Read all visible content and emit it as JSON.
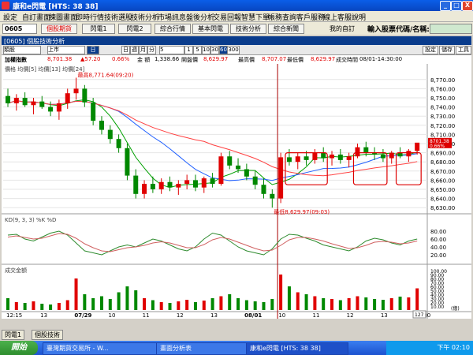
{
  "window": {
    "title": "康和e閃電 [HTS: 38 38]",
    "min": "_",
    "max": "□",
    "close": "X"
  },
  "menu": [
    "設定",
    "自訂畫面",
    "揀圖畫面",
    "即時行情",
    "技術選股",
    "技術分析",
    "市場訊息",
    "盤後分析",
    "交易回報",
    "智慧下單",
    "帳務查詢",
    "客戶服務",
    "線上客服",
    "說明"
  ],
  "toolbar": {
    "code": "0605",
    "buttons": [
      "個股期貨",
      "閃電1",
      "閃電2",
      "綜合行情",
      "基本閃電",
      "技術分析",
      "綜合新聞"
    ],
    "favorites": "我的自訂",
    "search_label": "輸入股票代碼/名稱:",
    "search_value": ""
  },
  "panel": {
    "title": "[0605] 個股技術分析",
    "btns": [
      "設定",
      "儲存",
      "工具"
    ]
  },
  "controls": {
    "market": "類股",
    "exch": "上市",
    "period_sel": "日",
    "periods": [
      "日",
      "週",
      "月",
      "分"
    ],
    "mins": "5",
    "scales": [
      "1",
      "5",
      "10",
      "30",
      "60"
    ],
    "active_scale": "60",
    "extra": "300"
  },
  "info": {
    "name": "加權指數",
    "price": "8,701.38",
    "change": "▲57.20",
    "pct": "0.66%",
    "amount_label": "金 額",
    "amount": "1,338.66",
    "high_label": "最高價",
    "high": "8,707.07",
    "low_label": "最低價",
    "low": "8,629.97",
    "open_label": "開盤價",
    "open": "8,629.97",
    "time_label": "成交時間",
    "time": "08/01-14:30:00"
  },
  "chart_data": {
    "type": "candlestick",
    "price_legend": "價格 均價[5] 均價[13] 均價[24]",
    "kd_legend": "KD(9, 3, 3) %K %D",
    "vol_legend": "成交金額",
    "price_ticks": [
      "8,770.00",
      "8,760.00",
      "8,750.00",
      "8,740.00",
      "8,730.00",
      "8,720.00",
      "8,710.00",
      "8,700.00",
      "8,690.00",
      "8,680.00",
      "8,670.00",
      "8,660.00",
      "8,650.00",
      "8,640.00",
      "8,630.00"
    ],
    "price_range": [
      8625,
      8775
    ],
    "kd_ticks": [
      "80.00",
      "60.00",
      "40.00",
      "20.00"
    ],
    "vol_ticks": [
      "100.00",
      "90.00",
      "80.00",
      "70.00",
      "60.00",
      "50.00",
      "40.00",
      "30.00",
      "20.00",
      "10.00"
    ],
    "vol_unit": "(億)",
    "x_labels": [
      "12:15",
      "13",
      "07/29",
      "10",
      "11",
      "12",
      "13",
      "08/01",
      "10",
      "11",
      "12",
      "13",
      "13:30"
    ],
    "high_note": "最高8,771.64(09:20)",
    "low_note": "最低8,629.97(09:03)",
    "last_price_tag": "8701.38",
    "last_pct_tag": "0.66%",
    "page_box": "127",
    "candles": [
      [
        8752,
        8760,
        8740,
        8744
      ],
      [
        8744,
        8754,
        8736,
        8750
      ],
      [
        8750,
        8756,
        8740,
        8742
      ],
      [
        8742,
        8750,
        8732,
        8746
      ],
      [
        8746,
        8752,
        8738,
        8740
      ],
      [
        8740,
        8746,
        8730,
        8735
      ],
      [
        8735,
        8748,
        8726,
        8744
      ],
      [
        8744,
        8760,
        8738,
        8755
      ],
      [
        8755,
        8772,
        8748,
        8760
      ],
      [
        8760,
        8764,
        8740,
        8745
      ],
      [
        8745,
        8750,
        8720,
        8725
      ],
      [
        8725,
        8730,
        8710,
        8715
      ],
      [
        8715,
        8720,
        8700,
        8705
      ],
      [
        8705,
        8710,
        8690,
        8695
      ],
      [
        8695,
        8700,
        8660,
        8665
      ],
      [
        8665,
        8672,
        8640,
        8645
      ],
      [
        8645,
        8660,
        8640,
        8656
      ],
      [
        8656,
        8664,
        8646,
        8650
      ],
      [
        8650,
        8662,
        8645,
        8658
      ],
      [
        8658,
        8664,
        8648,
        8652
      ],
      [
        8652,
        8660,
        8644,
        8656
      ],
      [
        8656,
        8666,
        8650,
        8660
      ],
      [
        8660,
        8666,
        8648,
        8652
      ],
      [
        8652,
        8664,
        8646,
        8662
      ],
      [
        8662,
        8668,
        8652,
        8656
      ],
      [
        8656,
        8690,
        8654,
        8686
      ],
      [
        8686,
        8692,
        8672,
        8676
      ],
      [
        8676,
        8684,
        8668,
        8672
      ],
      [
        8672,
        8678,
        8660,
        8664
      ],
      [
        8664,
        8670,
        8650,
        8655
      ],
      [
        8655,
        8662,
        8640,
        8645
      ],
      [
        8645,
        8650,
        8630,
        8640
      ],
      [
        8640,
        8690,
        8635,
        8685
      ],
      [
        8685,
        8694,
        8676,
        8680
      ],
      [
        8680,
        8690,
        8672,
        8686
      ],
      [
        8686,
        8692,
        8676,
        8682
      ],
      [
        8682,
        8694,
        8678,
        8690
      ],
      [
        8690,
        8696,
        8680,
        8684
      ],
      [
        8684,
        8692,
        8676,
        8688
      ],
      [
        8688,
        8694,
        8678,
        8682
      ],
      [
        8682,
        8690,
        8674,
        8686
      ],
      [
        8686,
        8700,
        8684,
        8696
      ],
      [
        8696,
        8702,
        8686,
        8690
      ],
      [
        8690,
        8696,
        8682,
        8688
      ],
      [
        8688,
        8694,
        8680,
        8684
      ],
      [
        8684,
        8692,
        8678,
        8690
      ],
      [
        8690,
        8696,
        8684,
        8686
      ],
      [
        8686,
        8694,
        8680,
        8692
      ],
      [
        8692,
        8700,
        8688,
        8701
      ]
    ],
    "kd_k": [
      70,
      72,
      60,
      55,
      65,
      75,
      80,
      70,
      50,
      30,
      25,
      20,
      30,
      40,
      45,
      40,
      50,
      60,
      55,
      45,
      35,
      30,
      40,
      60,
      75,
      70,
      55,
      40,
      30,
      25,
      20,
      35,
      60,
      72,
      70,
      62,
      55,
      45,
      40,
      35,
      30,
      40,
      55,
      62,
      58,
      50,
      45,
      55,
      60
    ],
    "kd_d": [
      65,
      68,
      64,
      60,
      62,
      68,
      74,
      72,
      62,
      48,
      38,
      30,
      28,
      33,
      38,
      40,
      44,
      50,
      53,
      50,
      44,
      38,
      38,
      46,
      58,
      64,
      60,
      52,
      44,
      36,
      30,
      32,
      44,
      58,
      64,
      64,
      60,
      55,
      48,
      42,
      36,
      38,
      44,
      52,
      54,
      52,
      48,
      50,
      55
    ],
    "volumes": [
      30,
      20,
      18,
      22,
      16,
      14,
      18,
      25,
      80,
      40,
      30,
      35,
      28,
      45,
      60,
      50,
      30,
      25,
      20,
      18,
      22,
      26,
      20,
      24,
      30,
      35,
      40,
      30,
      25,
      22,
      20,
      28,
      90,
      60,
      45,
      40,
      35,
      30,
      28,
      25,
      30,
      35,
      32,
      28,
      26,
      30,
      34,
      32,
      55
    ]
  },
  "bottom_tabs": [
    "閃電1",
    "個股技術"
  ],
  "taskbar": {
    "start": "開始",
    "tasks": [
      "臺灣期貨交易所 - W...",
      "畫面分析表",
      "康和e閃電 [HTS: 38 38]"
    ],
    "clock": "下午 02:10"
  }
}
